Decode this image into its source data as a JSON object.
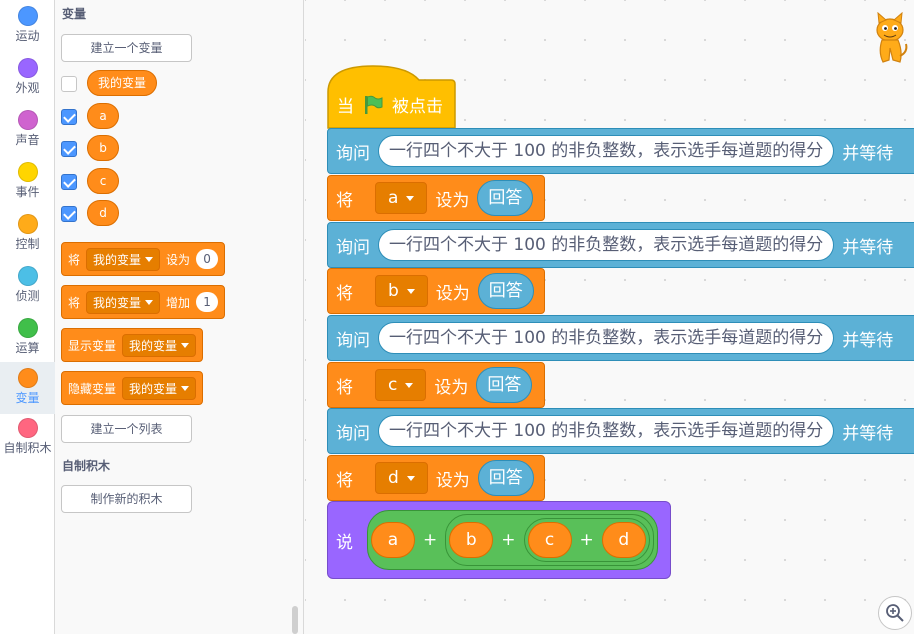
{
  "categories": [
    {
      "label": "运动",
      "color": "#4c97ff"
    },
    {
      "label": "外观",
      "color": "#9966ff"
    },
    {
      "label": "声音",
      "color": "#cf63cf"
    },
    {
      "label": "事件",
      "color": "#ffd500"
    },
    {
      "label": "控制",
      "color": "#ffab19"
    },
    {
      "label": "侦测",
      "color": "#4cbfe6"
    },
    {
      "label": "运算",
      "color": "#40bf4a"
    },
    {
      "label": "变量",
      "color": "#ff8c1a"
    },
    {
      "label": "自制积木",
      "color": "#ff6680"
    }
  ],
  "palette": {
    "variables_title": "变量",
    "make_variable_btn": "建立一个变量",
    "variables": [
      {
        "name": "我的变量",
        "checked": false
      },
      {
        "name": "a",
        "checked": true
      },
      {
        "name": "b",
        "checked": true
      },
      {
        "name": "c",
        "checked": true
      },
      {
        "name": "d",
        "checked": true
      }
    ],
    "set_block": {
      "keyword": "将",
      "var": "我的变量",
      "action": "设为",
      "value": "0"
    },
    "change_block": {
      "keyword": "将",
      "var": "我的变量",
      "action": "增加",
      "value": "1"
    },
    "show_block": {
      "keyword": "显示变量",
      "var": "我的变量"
    },
    "hide_block": {
      "keyword": "隐藏变量",
      "var": "我的变量"
    },
    "make_list_btn": "建立一个列表",
    "myblocks_title": "自制积木",
    "make_block_btn": "制作新的积木"
  },
  "script": {
    "hat": {
      "prefix": "当",
      "suffix": "被点击"
    },
    "ask_keyword": "询问",
    "ask_text": "一行四个不大于 100 的非负整数，表示选手每道题的得分",
    "ask_suffix": "并等待",
    "set_keyword": "将",
    "set_action": "设为",
    "answer": "回答",
    "vars": [
      "a",
      "b",
      "c",
      "d"
    ],
    "say_keyword": "说",
    "plus": "+"
  }
}
